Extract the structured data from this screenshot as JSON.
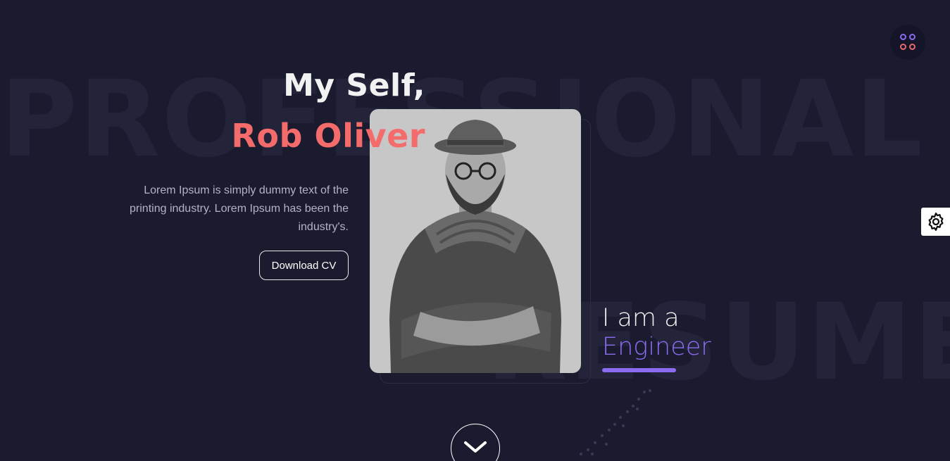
{
  "background": {
    "word_top": "PROFESSIONAL",
    "word_bottom": "RESUME"
  },
  "hero": {
    "greeting": "My Self,",
    "name": "Rob Oliver",
    "intro": "Lorem Ipsum is simply dummy text of the printing industry. Lorem Ipsum has been the industry's.",
    "download_label": "Download CV",
    "role_prefix": "I am a",
    "role": "Engineer"
  },
  "icons": {
    "menu": "menu-grid-icon",
    "settings": "gear-icon",
    "scroll": "chevron-down-icon",
    "portrait": "portrait-image"
  },
  "colors": {
    "background": "#1b1b2f",
    "accent_name": "#f36b6b",
    "accent_role": "#8b6cf0",
    "text_light": "#f2f2f2",
    "text_muted": "#b3b3c4"
  }
}
